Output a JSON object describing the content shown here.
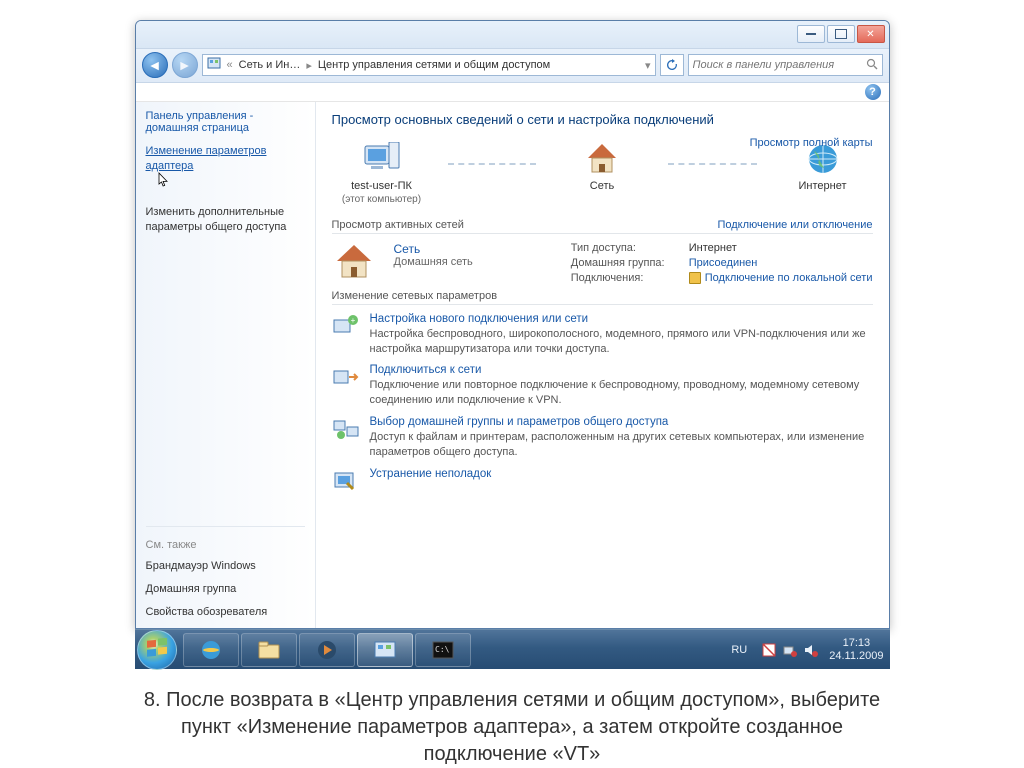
{
  "breadcrumb": {
    "part1": "Сеть и Ин…",
    "part2": "Центр управления сетями и общим доступом"
  },
  "search": {
    "placeholder": "Поиск в панели управления"
  },
  "sidebar": {
    "home": "Панель управления - домашняя страница",
    "link_adapter": "Изменение параметров адаптера",
    "link_sharing": "Изменить дополнительные параметры общего доступа",
    "see_also": "См. также",
    "footer1": "Брандмауэр Windows",
    "footer2": "Домашняя группа",
    "footer3": "Свойства обозревателя"
  },
  "main": {
    "heading": "Просмотр основных сведений о сети и настройка подключений",
    "map_link": "Просмотр полной карты",
    "node_pc": "test-user-ПК",
    "node_pc_sub": "(этот компьютер)",
    "node_net": "Сеть",
    "node_internet": "Интернет",
    "active_header": "Просмотр активных сетей",
    "active_right": "Подключение или отключение",
    "active_name": "Сеть",
    "active_sub": "Домашняя сеть",
    "prop_type_label": "Тип доступа:",
    "prop_type_value": "Интернет",
    "prop_group_label": "Домашняя группа:",
    "prop_group_value": "Присоединен",
    "prop_conn_label": "Подключения:",
    "prop_conn_value": "Подключение по локальной сети",
    "change_header": "Изменение сетевых параметров",
    "task1_title": "Настройка нового подключения или сети",
    "task1_desc": "Настройка беспроводного, широкополосного, модемного, прямого или VPN-подключения или же настройка маршрутизатора или точки доступа.",
    "task2_title": "Подключиться к сети",
    "task2_desc": "Подключение или повторное подключение к беспроводному, проводному, модемному сетевому соединению или подключение к VPN.",
    "task3_title": "Выбор домашней группы и параметров общего доступа",
    "task3_desc": "Доступ к файлам и принтерам, расположенным на других сетевых компьютерах, или изменение параметров общего доступа.",
    "task4_title": "Устранение неполадок"
  },
  "tray": {
    "lang": "RU",
    "time": "17:13",
    "date": "24.11.2009"
  },
  "caption": "8. После возврата в «Центр управления сетями и общим доступом», выберите пункт «Изменение параметров адаптера», а затем откройте созданное подключение «VT»"
}
